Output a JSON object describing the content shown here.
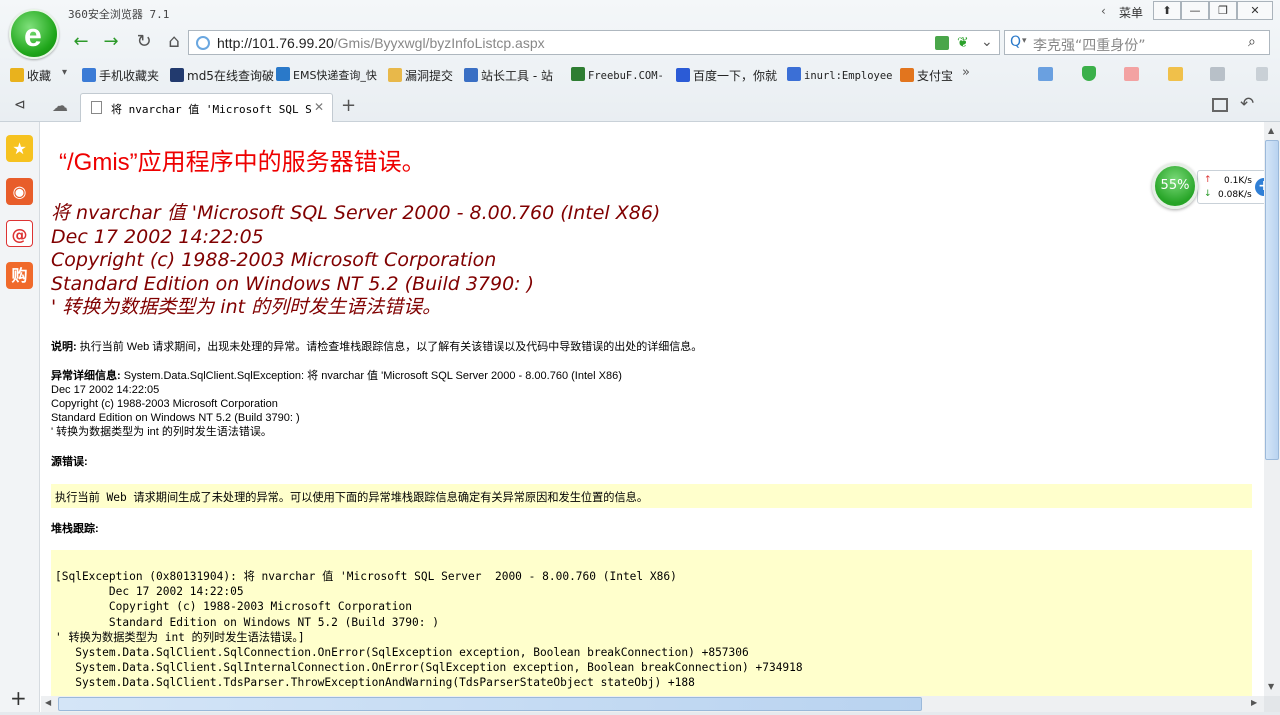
{
  "window": {
    "title": "360安全浏览器 7.1",
    "menu_label": "菜单",
    "controls": [
      "⬆",
      "—",
      "❐",
      "✕"
    ]
  },
  "toolbar": {
    "url_host": "http://101.76.99.20",
    "url_path": "/Gmis/Byyxwgl/byzInfoListcp.aspx",
    "search_placeholder": "李克强“四重身份”"
  },
  "bookmarks": {
    "favorites_label": "收藏",
    "items": [
      {
        "label": "手机收藏夹",
        "color": "#3b7bd6"
      },
      {
        "label": "md5在线查询破",
        "color": "#223a6e"
      },
      {
        "label": "EMS快递查询_快",
        "color": "#2a79c9"
      },
      {
        "label": "漏洞提交",
        "color": "#e8b84a"
      },
      {
        "label": "站长工具 - 站",
        "color": "#3a6fc4"
      },
      {
        "label": "FreebuF.COM-",
        "color": "#2e7d32"
      },
      {
        "label": "百度一下，你就",
        "color": "#2b5bd6"
      },
      {
        "label": "inurl:Employee",
        "color": "#3b6fd6"
      },
      {
        "label": "支付宝",
        "color": "#e2751e"
      }
    ]
  },
  "tab": {
    "title": "将 nvarchar 值 'Microsoft SQL Server"
  },
  "page": {
    "heading": "“/Gmis”应用程序中的服务器错误。",
    "error_lines": [
      "将 nvarchar 值 'Microsoft SQL Server  2000 - 8.00.760 (Intel X86)",
      "Dec 17 2002 14:22:05",
      "Copyright (c) 1988-2003 Microsoft Corporation",
      "Standard Edition on Windows NT 5.2 (Build 3790: )",
      "' 转换为数据类型为 int 的列时发生语法错误。"
    ],
    "desc_label": "说明:",
    "desc_text": " 执行当前 Web 请求期间，出现未处理的异常。请检查堆栈跟踪信息，以了解有关该错误以及代码中导致错误的出处的详细信息。",
    "exception_label": "异常详细信息:",
    "exception_lines": [
      " System.Data.SqlClient.SqlException: 将  nvarchar 值 'Microsoft SQL Server  2000 - 8.00.760 (Intel X86)",
      "Dec 17 2002 14:22:05",
      "Copyright (c) 1988-2003 Microsoft Corporation",
      "Standard Edition on Windows NT 5.2 (Build 3790: )",
      "' 转换为数据类型为  int 的列时发生语法错误。"
    ],
    "source_label": "源错误:",
    "source_text": "执行当前 Web 请求期间生成了未处理的异常。可以使用下面的异常堆栈跟踪信息确定有关异常原因和发生位置的信息。",
    "stack_label": "堆栈跟踪:",
    "stack_text": "[SqlException (0x80131904): 将 nvarchar 值 'Microsoft SQL Server  2000 - 8.00.760 (Intel X86)\n\tDec 17 2002 14:22:05\n\tCopyright (c) 1988-2003 Microsoft Corporation\n\tStandard Edition on Windows NT 5.2 (Build 3790: )\n' 转换为数据类型为 int 的列时发生语法错误。]\n   System.Data.SqlClient.SqlConnection.OnError(SqlException exception, Boolean breakConnection) +857306\n   System.Data.SqlClient.SqlInternalConnection.OnError(SqlException exception, Boolean breakConnection) +734918\n   System.Data.SqlClient.TdsParser.ThrowExceptionAndWarning(TdsParserStateObject stateObj) +188"
  },
  "widget": {
    "percent": "55%",
    "upload": "0.1K/s",
    "download": "0.08K/s"
  }
}
